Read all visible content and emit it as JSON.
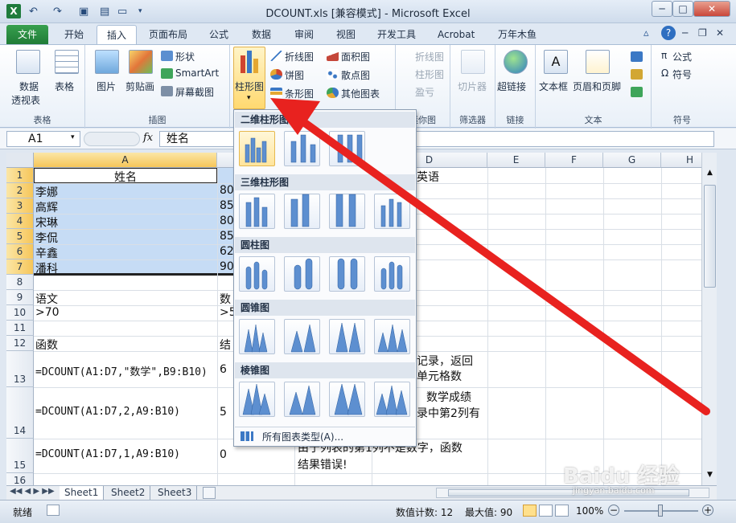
{
  "window": {
    "title": "DCOUNT.xls  [兼容模式] - Microsoft Excel",
    "minimize": "─",
    "maximize": "□",
    "close": "✕",
    "ribbon_minimize": "─",
    "ribbon_restore": "❐",
    "ribbon_close": "✕",
    "help": "?"
  },
  "tabs": [
    "文件",
    "开始",
    "插入",
    "页面布局",
    "公式",
    "数据",
    "审阅",
    "视图",
    "开发工具",
    "Acrobat",
    "万年木鱼"
  ],
  "ribbon": {
    "tables": {
      "pivot": "数据",
      "pivot2": "透视表",
      "table": "表格",
      "group": "表格"
    },
    "illustrations": {
      "picture": "图片",
      "clipart": "剪贴画",
      "shapes": "形状",
      "smartart": "SmartArt",
      "screenshot": "屏幕截图",
      "group": "插图"
    },
    "charts": {
      "column": "柱形图",
      "line": "折线图",
      "pie": "饼图",
      "bar": "条形图",
      "area": "面积图",
      "scatter": "散点图",
      "other": "其他图表",
      "group": "图表"
    },
    "sparklines": {
      "line": "折线图",
      "column": "柱形图",
      "winloss": "盈亏",
      "group": "迷你图"
    },
    "filter": {
      "slicer": "切片器",
      "group": "筛选器"
    },
    "links": {
      "hyperlink": "超链接",
      "group": "链接"
    },
    "text": {
      "textbox": "文本框",
      "headerfooter": "页眉和页脚",
      "group": "文本"
    },
    "symbols": {
      "equation": "公式",
      "symbol": "符号",
      "group": "符号"
    }
  },
  "formula_bar": {
    "name_box": "A1",
    "fx": "fx",
    "value": "姓名"
  },
  "columns": [
    "A",
    "B",
    "C",
    "D",
    "E",
    "F",
    "G",
    "H"
  ],
  "rows": [
    "1",
    "2",
    "3",
    "4",
    "5",
    "6",
    "7",
    "8",
    "9",
    "10",
    "11",
    "12",
    "13",
    "14",
    "15",
    "16"
  ],
  "cells": {
    "a1": "姓名",
    "a2": "李娜",
    "a3": "高辉",
    "a4": "宋琳",
    "a5": "李侃",
    "a6": "辛鑫",
    "a7": "潘科",
    "b2": "80",
    "b3": "85",
    "b4": "80",
    "b5": "85",
    "b6": "62",
    "b7": "90",
    "d1": "英语",
    "a9": "语文",
    "b9": "数",
    "a10": ">70",
    "b10": ">5",
    "a12": "函数",
    "b12": "结",
    "a13": "=DCOUNT(A1:D7,\"数学\",B9:B10)",
    "b13": "6",
    "d13a": "记录，返回",
    "d13b": "单元格数",
    "a14": "=DCOUNT(A1:D7,2,A9:B10)",
    "b14": "5",
    "d14a": "数学成绩",
    "d14b": "录中第2列有",
    "a15": "=DCOUNT(A1:D7,1,A9:B10)",
    "b15": "0",
    "d15a": "由于列表的第1列不是数字，函数",
    "d15b": "结果错误!"
  },
  "sheets": [
    "Sheet1",
    "Sheet2",
    "Sheet3"
  ],
  "status": {
    "ready": "就绪",
    "count": "数值计数: 12",
    "max": "最大值: 90",
    "zoom": "100%"
  },
  "dropdown": {
    "sections": [
      "二维柱形图",
      "三维柱形图",
      "圆柱图",
      "圆锥图",
      "棱锥图"
    ],
    "footer": "所有图表类型(A)..."
  },
  "watermark": {
    "brand": "Baidu 经验",
    "url": "jingyan.baidu.com"
  },
  "colors": {
    "accent": "#1f7a36",
    "selection": "#c6dcf5",
    "arrow": "#e8221f"
  }
}
